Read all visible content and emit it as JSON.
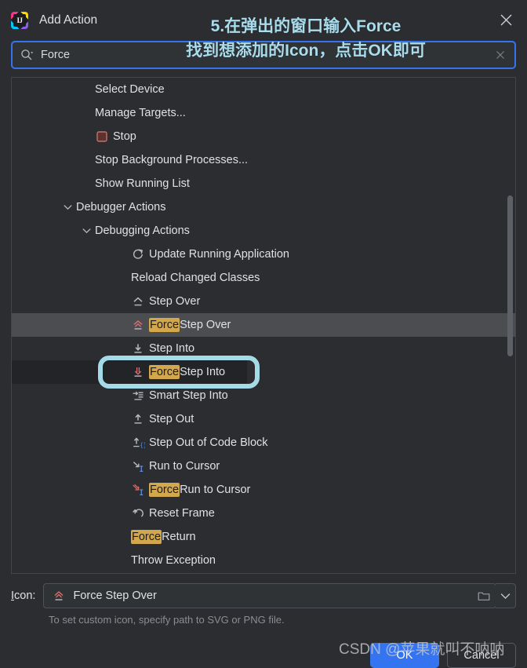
{
  "window": {
    "title": "Add Action",
    "logo_text": "IJ",
    "logo_icon": "intellij-idea-logo",
    "close_icon": "close-icon"
  },
  "annotation": {
    "line1": "5.在弹出的窗口输入Force",
    "line2": "找到想添加的Icon，点击OK即可",
    "color": "#a9dcec",
    "ring_color": "#a5dbe9"
  },
  "search": {
    "value": "Force",
    "icon": "search-icon",
    "clear_icon": "close-icon",
    "border_color": "#3574f0"
  },
  "list": {
    "items": [
      {
        "label": "Select Device",
        "indent": 106,
        "icon": "none",
        "chevron": "none"
      },
      {
        "label": "Manage Targets...",
        "indent": 106,
        "icon": "none",
        "chevron": "none"
      },
      {
        "label": "Stop",
        "indent": 106,
        "icon": "stop-icon",
        "chevron": "none"
      },
      {
        "label": "Stop Background Processes...",
        "indent": 106,
        "icon": "none",
        "chevron": "none"
      },
      {
        "label": "Show Running List",
        "indent": 106,
        "icon": "none",
        "chevron": "none"
      },
      {
        "label": "Debugger Actions",
        "indent": 82,
        "icon": "none",
        "chevron": "chevron-down-icon"
      },
      {
        "label": "Debugging Actions",
        "indent": 106,
        "icon": "none",
        "chevron": "chevron-down-icon"
      },
      {
        "label": "Update Running Application",
        "indent": 152,
        "icon": "refresh-icon",
        "chevron": "none"
      },
      {
        "label": "Reload Changed Classes",
        "indent": 152,
        "icon": "none",
        "chevron": "none"
      },
      {
        "label": "Step Over",
        "indent": 152,
        "icon": "step-over-icon",
        "chevron": "none"
      },
      {
        "label": "Step Over",
        "highlight": "Force",
        "indent": 152,
        "icon": "force-step-over-icon",
        "chevron": "none",
        "state": "selected"
      },
      {
        "label": "Step Into",
        "indent": 152,
        "icon": "step-into-icon",
        "chevron": "none"
      },
      {
        "label": "Step Into",
        "highlight": "Force",
        "indent": 152,
        "icon": "force-step-into-icon",
        "chevron": "none",
        "state": "boxed"
      },
      {
        "label": "Smart Step Into",
        "indent": 152,
        "icon": "smart-step-into-icon",
        "chevron": "none"
      },
      {
        "label": "Step Out",
        "indent": 152,
        "icon": "step-out-icon",
        "chevron": "none"
      },
      {
        "label": "Step Out of Code Block",
        "indent": 152,
        "icon": "step-out-code-block-icon",
        "chevron": "none"
      },
      {
        "label": "Run to Cursor",
        "indent": 152,
        "icon": "run-to-cursor-icon",
        "chevron": "none"
      },
      {
        "label": "Run to Cursor",
        "highlight": "Force",
        "indent": 152,
        "icon": "force-run-to-cursor-icon",
        "chevron": "none"
      },
      {
        "label": "Reset Frame",
        "indent": 152,
        "icon": "reset-frame-icon",
        "chevron": "none"
      },
      {
        "label": "Return",
        "highlight": "Force",
        "indent": 152,
        "icon": "none",
        "chevron": "none"
      },
      {
        "label": "Throw Exception",
        "indent": 152,
        "icon": "none",
        "chevron": "none"
      }
    ],
    "highlight_bg": "#d3a84c",
    "selected_bg": "#4b4d51"
  },
  "icon_field": {
    "label": "Icon:",
    "label_mnemonic": "I",
    "value": "Force Step Over",
    "value_icon": "force-step-over-icon",
    "browse_icon": "folder-icon",
    "dropdown_icon": "chevron-down-icon",
    "hint": "To set custom icon, specify path to SVG or PNG file."
  },
  "buttons": {
    "ok": "OK",
    "cancel": "Cancel",
    "ok_color": "#3574f0"
  },
  "watermark": "CSDN @苹果就叫不呐呐"
}
